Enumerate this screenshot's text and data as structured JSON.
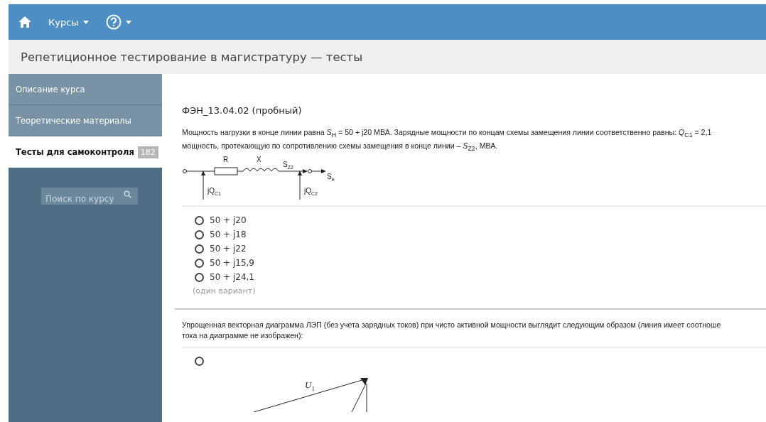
{
  "navbar": {
    "menus": [
      {
        "kind": "home"
      },
      {
        "kind": "text",
        "label": "Курсы"
      },
      {
        "kind": "help"
      }
    ]
  },
  "page_title": "Репетиционное тестирование в магистратуру — тесты",
  "sidebar": {
    "items": [
      {
        "label": "Описание курса",
        "selected": false
      },
      {
        "label": "Теоретические материалы",
        "selected": false
      },
      {
        "label": "Тесты для самоконтроля",
        "selected": true,
        "badge": "182"
      }
    ],
    "search": {
      "placeholder": "Поиск по курсу"
    }
  },
  "test_title": "ФЭН_13.04.02 (пробный)",
  "questions": [
    {
      "lines": [
        "Мощность нагрузки в конце линии равна *S*$_{Н}$ = 50 + j20  МВА. Зарядные мощности по концам схемы замещения линии соответственно равны: *Q*$_{C1}$ = 2,1",
        "мощность, протекающую по сопротивлению схемы замещения в конце линии – *S*$_{Z2}$, МВА."
      ],
      "circuit": {
        "labels": [
          "R",
          "X",
          "S$_{Z2}$",
          "S$_{н}$",
          "jQ$_{C1}$",
          "jQ$_{C2}$"
        ]
      },
      "options": [
        {
          "label": "50 + j20",
          "selected": false
        },
        {
          "label": "50 + j18",
          "selected": false
        },
        {
          "label": "50 + j22",
          "selected": false
        },
        {
          "label": "50 + j15,9",
          "selected": false
        },
        {
          "label": "50 + j24,1",
          "selected": false
        }
      ],
      "hint": "(один вариант)"
    },
    {
      "lines": [
        "Упрощенная векторная диаграмма ЛЭП (без учета зарядных токов) при чисто активной мощности выглядит следующим образом (линия имеет соотноше",
        "тока на диаграмме не изображен):"
      ],
      "diagram_options": [
        {
          "selected": false,
          "vector_label": "*U*$_{1}$"
        }
      ]
    }
  ]
}
